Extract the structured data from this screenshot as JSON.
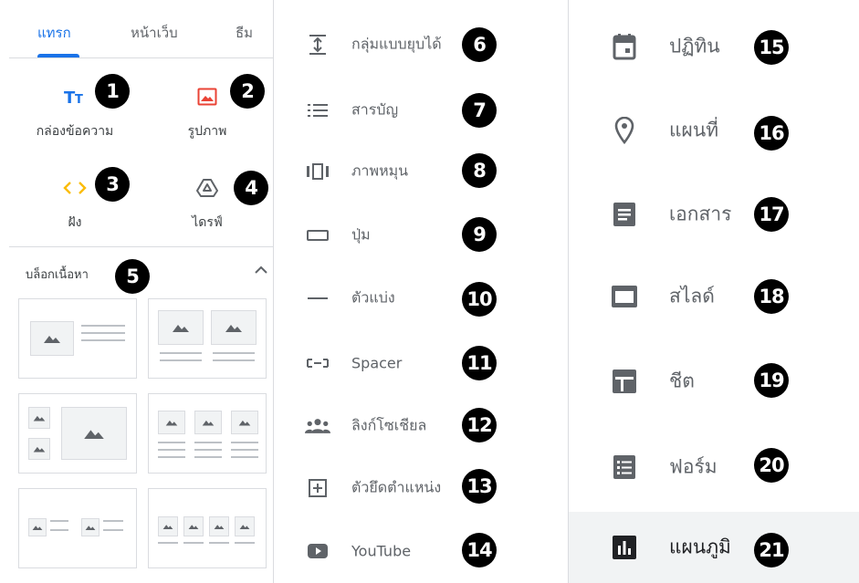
{
  "tabs": [
    {
      "label": "แทรก",
      "active": true
    },
    {
      "label": "หน้าเว็บ",
      "active": false
    },
    {
      "label": "ธีม",
      "active": false
    }
  ],
  "insert_items": [
    {
      "label": "กล่องข้อความ",
      "icon": "text-box-icon",
      "color": "#1a73e8",
      "badge": "1"
    },
    {
      "label": "รูปภาพ",
      "icon": "image-icon",
      "color": "#ea4335",
      "badge": "2"
    },
    {
      "label": "ฝัง",
      "icon": "embed-icon",
      "color": "#fbbc04",
      "badge": "3"
    },
    {
      "label": "ไดรฟ์",
      "icon": "drive-icon",
      "color": "#5f6368",
      "badge": "4"
    }
  ],
  "content_blocks": {
    "title": "บล็อกเนื้อหา",
    "badge": "5"
  },
  "middle_items": [
    {
      "label": "กลุ่มแบบยุบได้",
      "icon": "collapsible-group-icon",
      "badge": "6"
    },
    {
      "label": "สารบัญ",
      "icon": "table-of-contents-icon",
      "badge": "7"
    },
    {
      "label": "ภาพหมุน",
      "icon": "carousel-icon",
      "badge": "8"
    },
    {
      "label": "ปุ่ม",
      "icon": "button-icon",
      "badge": "9"
    },
    {
      "label": "ตัวแบ่ง",
      "icon": "divider-icon",
      "badge": "10"
    },
    {
      "label": "Spacer",
      "icon": "spacer-icon",
      "badge": "11"
    },
    {
      "label": "ลิงก์โซเชียล",
      "icon": "social-links-icon",
      "badge": "12"
    },
    {
      "label": "ตัวยึดตำแหน่ง",
      "icon": "placeholder-icon",
      "badge": "13"
    },
    {
      "label": "YouTube",
      "icon": "youtube-icon",
      "badge": "14"
    }
  ],
  "google_items": [
    {
      "label": "ปฏิทิน",
      "icon": "calendar-icon",
      "badge": "15"
    },
    {
      "label": "แผนที่",
      "icon": "map-pin-icon",
      "badge": "16"
    },
    {
      "label": "เอกสาร",
      "icon": "docs-icon",
      "badge": "17"
    },
    {
      "label": "สไลด์",
      "icon": "slides-icon",
      "badge": "18"
    },
    {
      "label": "ชีต",
      "icon": "sheets-icon",
      "badge": "19"
    },
    {
      "label": "ฟอร์ม",
      "icon": "forms-icon",
      "badge": "20"
    },
    {
      "label": "แผนภูมิ",
      "icon": "charts-icon",
      "badge": "21",
      "selected": true
    }
  ]
}
